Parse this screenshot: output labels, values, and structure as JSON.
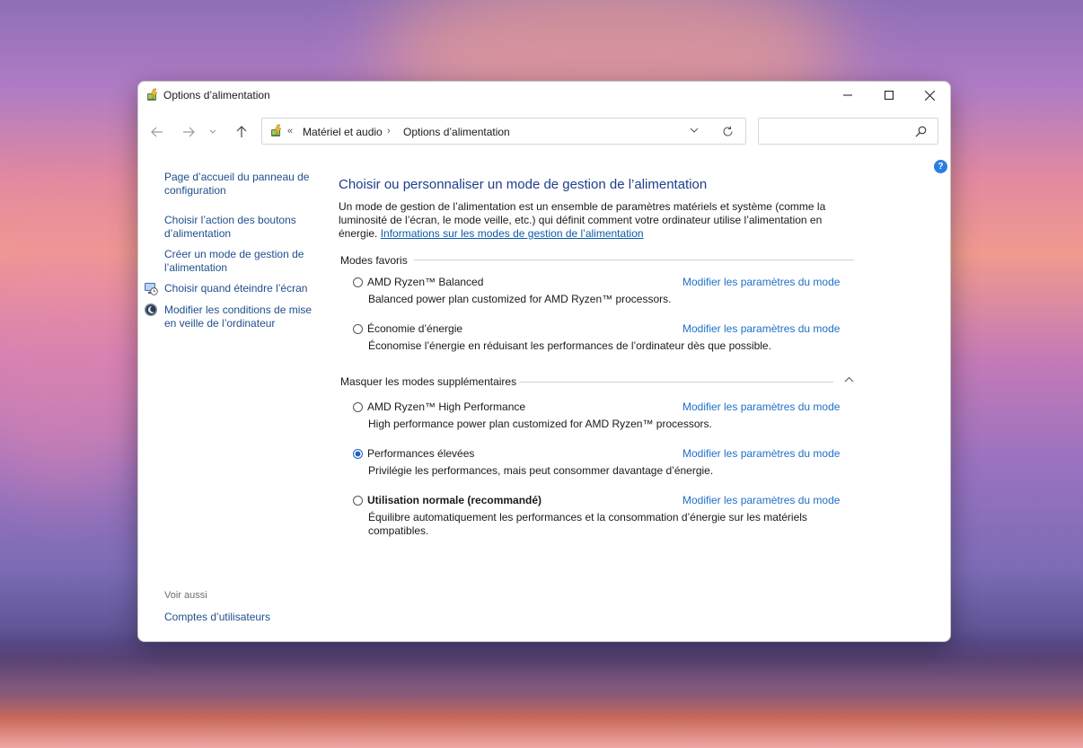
{
  "window": {
    "title": "Options d’alimentation"
  },
  "address_bar": {
    "overflow": "«",
    "crumbs": [
      "Matériel et audio",
      "Options d’alimentation"
    ],
    "separator": "›"
  },
  "search": {
    "placeholder": "",
    "value": ""
  },
  "sidebar": {
    "items": [
      {
        "label": "Page d’accueil du panneau de configuration",
        "icon": null
      },
      {
        "label": "Choisir l’action des boutons d’alimentation",
        "icon": null
      },
      {
        "label": "Créer un mode de gestion de l’alimentation",
        "icon": null
      },
      {
        "label": "Choisir quand éteindre l’écran",
        "icon": "monitor-clock-icon"
      },
      {
        "label": "Modifier les conditions de mise en veille de l’ordinateur",
        "icon": "moon-icon"
      }
    ],
    "see_also_label": "Voir aussi",
    "see_also_items": [
      "Comptes d’utilisateurs"
    ]
  },
  "main": {
    "title": "Choisir ou personnaliser un mode de gestion de l’alimentation",
    "description": "Un mode de gestion de l’alimentation est un ensemble de paramètres matériels et système (comme la luminosité de l’écran, le mode veille, etc.) qui définit comment votre ordinateur utilise l’alimentation en énergie.",
    "info_link": "Informations sur les modes de gestion de l’alimentation",
    "favorites_header": "Modes favoris",
    "extra_header": "Masquer les modes supplémentaires",
    "change_link_label": "Modifier les paramètres du mode",
    "favorite_plans": [
      {
        "name": "AMD Ryzen™ Balanced",
        "desc": "Balanced power plan customized for AMD Ryzen™ processors.",
        "selected": false,
        "bold": false
      },
      {
        "name": "Économie d’énergie",
        "desc": "Économise l’énergie en réduisant les performances de l’ordinateur dès que possible.",
        "selected": false,
        "bold": false
      }
    ],
    "extra_plans": [
      {
        "name": "AMD Ryzen™ High Performance",
        "desc": "High performance power plan customized for AMD Ryzen™ processors.",
        "selected": false,
        "bold": false
      },
      {
        "name": "Performances élevées",
        "desc": "Privilégie les performances, mais peut consommer davantage d’énergie.",
        "selected": true,
        "bold": false
      },
      {
        "name": "Utilisation normale (recommandé)",
        "desc": "Équilibre automatiquement les performances et la consommation d’énergie sur les matériels compatibles.",
        "selected": false,
        "bold": true
      }
    ]
  },
  "help_label": "?",
  "colors": {
    "link": "#1f6fc8",
    "title": "#1e3e8c",
    "radio_selected": "#1f5fbf"
  }
}
